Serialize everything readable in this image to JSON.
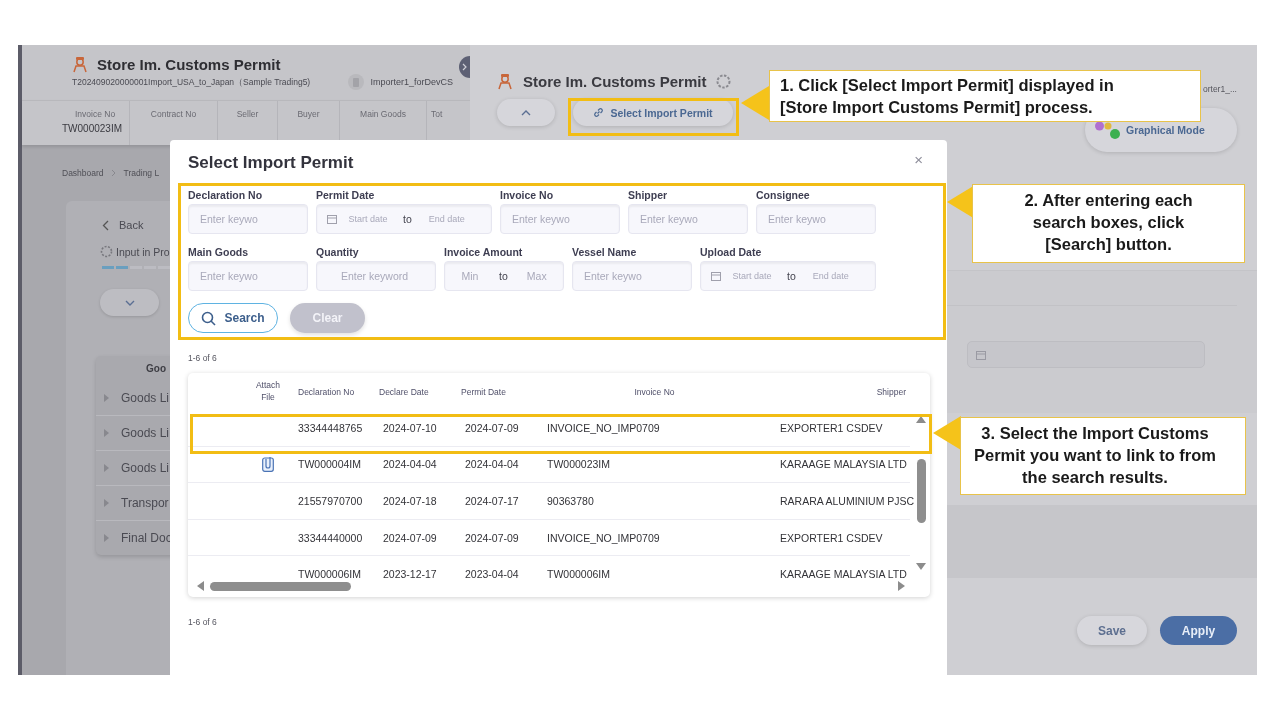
{
  "left_page": {
    "title": "Store Im. Customs Permit",
    "subtitle": "T202409020000001Import_USA_to_Japan（Sample Trading5)",
    "user": "Importer1_forDevCS",
    "summary_columns": [
      {
        "label": "Invoice No",
        "value": "TW000023IM"
      },
      {
        "label": "Contract No"
      },
      {
        "label": "Seller"
      },
      {
        "label": "Buyer"
      },
      {
        "label": "Main Goods"
      },
      {
        "label": "Tot"
      }
    ],
    "breadcrumb": [
      "Dashboard",
      "Trading L"
    ],
    "back": "Back",
    "status": "Input in Pro",
    "progress": {
      "level": 0.38
    },
    "goods_table": {
      "header": "Goo",
      "rows": [
        "Goods Li",
        "Goods Li",
        "Goods Li",
        "Transpor",
        "Final Doc"
      ]
    }
  },
  "right_panel": {
    "title": "Store Im. Customs Permit",
    "select_button": "Select Import Permit",
    "user": "orter1_...",
    "mode_button": "Graphical Mode",
    "buttons": [
      {
        "label": "Save",
        "kind": "secondary"
      },
      {
        "label": "Apply",
        "kind": "primary"
      }
    ]
  },
  "modal": {
    "title": "Select Import Permit",
    "close": "×",
    "filters": [
      [
        {
          "label": "Declaration No",
          "kind": "text",
          "placeholder": "Enter keywo"
        },
        {
          "label": "Permit Date",
          "kind": "date_range",
          "inputs": [
            {
              "placeholder": "Start date"
            },
            {
              "placeholder": "End date"
            }
          ],
          "separator": "to"
        },
        {
          "label": "Invoice No",
          "kind": "text",
          "placeholder": "Enter keywo"
        },
        {
          "label": "Shipper",
          "kind": "text",
          "placeholder": "Enter keywo"
        },
        {
          "label": "Consignee",
          "kind": "text",
          "placeholder": "Enter keywo"
        }
      ],
      [
        {
          "label": "Main Goods",
          "kind": "text",
          "placeholder": "Enter keywo"
        },
        {
          "label": "Quantity",
          "kind": "text",
          "placeholder": "Enter keyword"
        },
        {
          "label": "Invoice Amount",
          "kind": "number_range",
          "inputs": [
            {
              "placeholder": "Min"
            },
            {
              "placeholder": "Max"
            }
          ],
          "separator": "to"
        },
        {
          "label": "Vessel Name",
          "kind": "text",
          "placeholder": "Enter keywo"
        },
        {
          "label": "Upload Date",
          "kind": "date_range",
          "inputs": [
            {
              "placeholder": "Start date"
            },
            {
              "placeholder": "End date"
            }
          ],
          "separator": "to"
        }
      ]
    ],
    "search_button": "Search",
    "clear_button": {
      "label": "Clear",
      "disabled": true
    },
    "result_count": "1-6 of 6",
    "table": {
      "attach_column": "Attach File",
      "columns": [
        "Declaration No",
        "Declare Date",
        "Permit Date",
        "Invoice No",
        "Shipper"
      ],
      "rows": [
        {
          "attachment": false,
          "cells": [
            "33344448765",
            "2024-07-10",
            "2024-07-09",
            "INVOICE_NO_IMP0709",
            "EXPORTER1 CSDEV"
          ]
        },
        {
          "attachment": true,
          "cells": [
            "TW000004IM",
            "2024-04-04",
            "2024-04-04",
            "TW000023IM",
            "KARAAGE MALAYSIA LTD"
          ]
        },
        {
          "attachment": false,
          "cells": [
            "21557970700",
            "2024-07-18",
            "2024-07-17",
            "90363780",
            "RARARA ALUMINIUM PJSC"
          ]
        },
        {
          "attachment": false,
          "cells": [
            "33344440000",
            "2024-07-09",
            "2024-07-09",
            "INVOICE_NO_IMP0709",
            "EXPORTER1 CSDEV"
          ]
        },
        {
          "attachment": false,
          "cells": [
            "TW000006IM",
            "2023-12-17",
            "2023-04-04",
            "TW000006IM",
            "KARAAGE MALAYSIA LTD"
          ]
        }
      ]
    },
    "footer_count": "1-6 of 6"
  },
  "callouts": [
    {
      "text": "1. Click [Select Import Permit] displayed in [Store Import Customs Permit] process."
    },
    {
      "text": "2. After entering each search boxes, click [Search] button."
    },
    {
      "text": "3. Select the Import Customs Permit you want to link to from the search results."
    }
  ]
}
